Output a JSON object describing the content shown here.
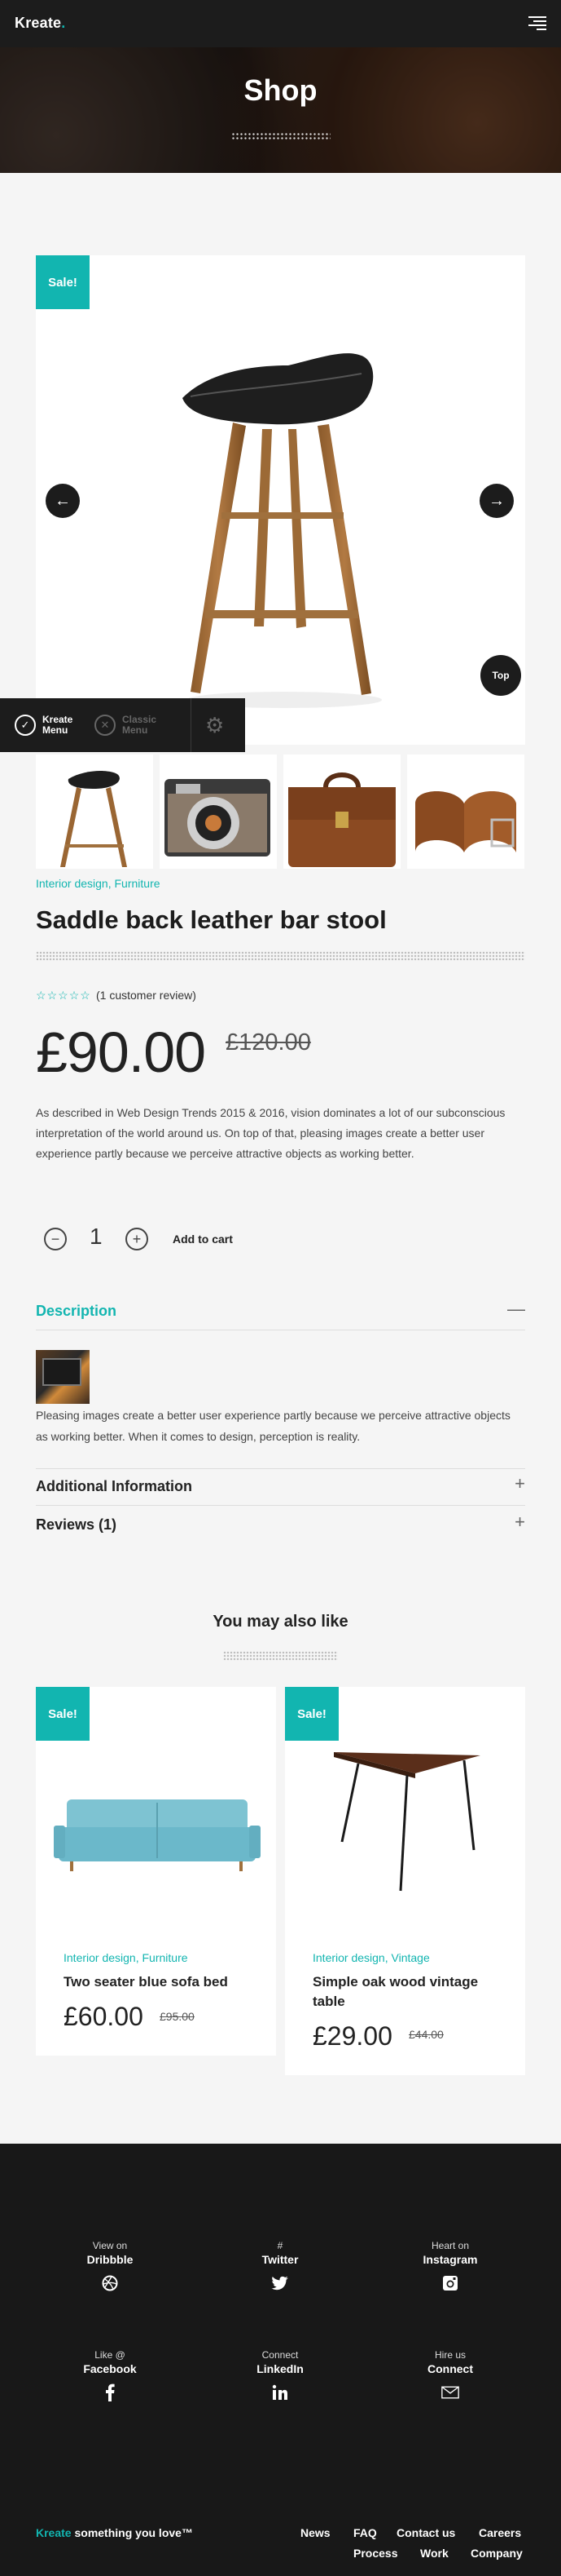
{
  "header": {
    "logo": "Kreate",
    "logo_dot": ".",
    "menu_icon": "hamburger-icon"
  },
  "hero": {
    "title": "Shop"
  },
  "product": {
    "sale_badge": "Sale!",
    "prev_icon": "arrow-left-icon",
    "next_icon": "arrow-right-icon",
    "top_label": "Top",
    "thumbnails": [
      "bar stool",
      "vintage camera",
      "leather satchel",
      "leather belts"
    ],
    "categories": "Interior design, Furniture",
    "title": "Saddle back leather bar stool",
    "rating": 0,
    "rating_max": 5,
    "review_text": "(1 customer review)",
    "price": "£90.00",
    "old_price": "£120.00",
    "description": "As described in Web Design Trends 2015 & 2016, vision dominates a lot of our subconscious interpretation of the world around us. On top of that, pleasing images create a better user experience partly because we perceive attractive objects as working better.",
    "quantity": "1",
    "add_to_cart": "Add to cart"
  },
  "kreate_menu": {
    "kreate_label_1": "Kreate",
    "kreate_label_2": "Menu",
    "classic_label_1": "Classic",
    "classic_label_2": "Menu"
  },
  "tabs": {
    "description_title": "Description",
    "description_toggle": "—",
    "description_text": "Pleasing images create a better user experience partly because we perceive attractive objects as working better. When it comes to design, perception is reality.",
    "additional_title": "Additional Information",
    "additional_toggle": "+",
    "reviews_title": "Reviews (1)",
    "reviews_toggle": "+"
  },
  "related": {
    "title": "You may also like",
    "items": [
      {
        "sale": "Sale!",
        "categories": "Interior design, Furniture",
        "name": "Two seater blue sofa bed",
        "price": "£60.00",
        "old_price": "£95.00"
      },
      {
        "sale": "Sale!",
        "categories": "Interior design, Vintage",
        "name": "Simple oak wood vintage table",
        "price": "£29.00",
        "old_price": "£44.00"
      }
    ]
  },
  "footer": {
    "socials": [
      {
        "pre": "View on",
        "network": "Dribbble",
        "icon": "dribbble-icon"
      },
      {
        "pre": "#",
        "network": "Twitter",
        "icon": "twitter-icon"
      },
      {
        "pre": "Heart on",
        "network": "Instagram",
        "icon": "instagram-icon"
      },
      {
        "pre": "Like @",
        "network": "Facebook",
        "icon": "facebook-icon"
      },
      {
        "pre": "Connect",
        "network": "LinkedIn",
        "icon": "linkedin-icon"
      },
      {
        "pre": "Hire us",
        "network": "Connect",
        "icon": "mail-icon"
      }
    ],
    "brand": "Kreate",
    "tagline": " something you love™",
    "links": [
      "News",
      "FAQ",
      "Contact us",
      "Careers",
      "Process",
      "Work",
      "Company"
    ]
  },
  "colors": {
    "accent": "#12b5b0",
    "dark": "#1c1c1c",
    "footer": "#181818"
  }
}
